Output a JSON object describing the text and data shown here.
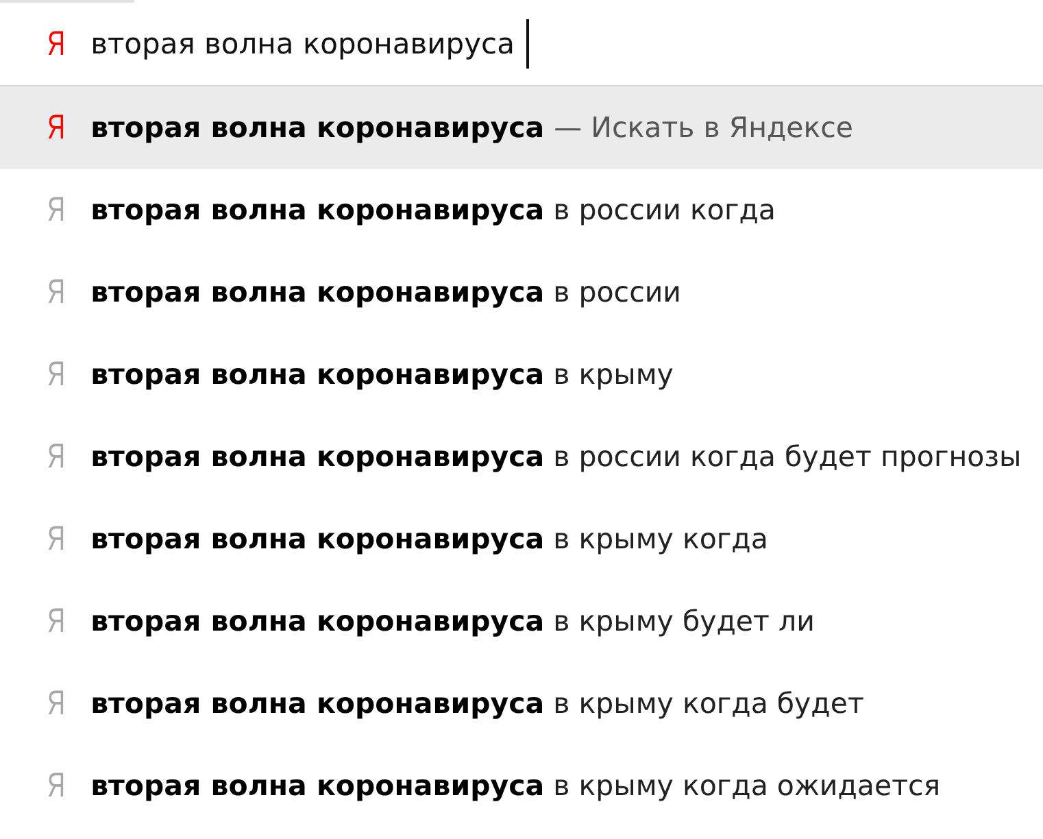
{
  "search_field": {
    "icon": "Я",
    "value": "вторая волна коронавируса"
  },
  "suggestions": [
    {
      "kind": "search",
      "icon": "Я",
      "text": "**вторая волна коронавируса**",
      "hint": "— Искать в Яндексе",
      "selected": true
    },
    {
      "kind": "suggest",
      "icon": "Я",
      "text": "**вторая волна коронавируса** в россии когда",
      "selected": false
    },
    {
      "kind": "suggest",
      "icon": "Я",
      "text": "**вторая волна коронавируса** в россии",
      "selected": false
    },
    {
      "kind": "suggest",
      "icon": "Я",
      "text": "**вторая волна коронавируса** в крыму",
      "selected": false
    },
    {
      "kind": "suggest",
      "icon": "Я",
      "text": "**вторая волна коронавируса** в россии когда будет прогнозы",
      "selected": false
    },
    {
      "kind": "suggest",
      "icon": "Я",
      "text": "**вторая волна коронавируса** в крыму когда",
      "selected": false
    },
    {
      "kind": "suggest",
      "icon": "Я",
      "text": "**вторая волна коронавируса** в крыму будет ли",
      "selected": false
    },
    {
      "kind": "suggest",
      "icon": "Я",
      "text": "**вторая волна коронавируса** в крыму когда будет",
      "selected": false
    },
    {
      "kind": "suggest",
      "icon": "Я",
      "text": "**вторая волна коронавируса** в крыму когда ожидается",
      "selected": false
    }
  ]
}
